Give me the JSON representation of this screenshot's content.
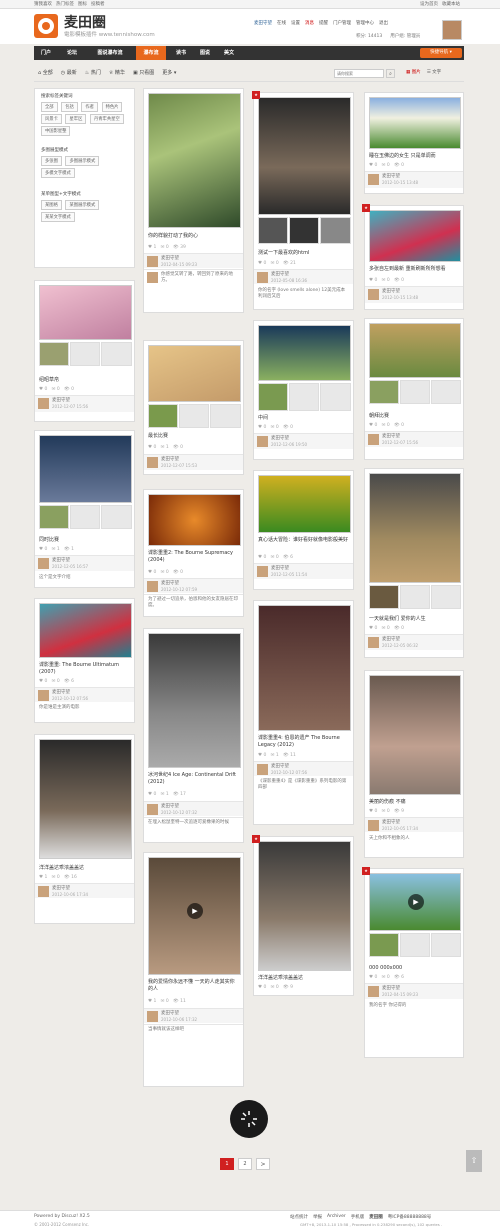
{
  "topbar": {
    "links": [
      "猜我喜欢",
      "热门标签",
      "图标",
      "投稿者"
    ],
    "right": [
      "设为首页",
      "收藏本站"
    ]
  },
  "header": {
    "logo_text": "麦田圈",
    "subtitle": "電影模板插件 www.tennishow.com",
    "user": "麦田守望",
    "status": "在线",
    "links": [
      "设置",
      "消息",
      "提醒",
      "门户管理",
      "管理中心",
      "退出"
    ],
    "score": "积分: 14413",
    "group": "用户组: 管理员"
  },
  "nav": {
    "items": [
      "门户",
      "论坛",
      "图说瀑布流",
      "瀑布流",
      "读书",
      "图说",
      "美文"
    ],
    "quick": "快捷导航"
  },
  "filter": {
    "items": [
      "全部",
      "最新",
      "热门",
      "精华",
      "只看图",
      "更多"
    ],
    "search_placeholder": "请你搜索",
    "view_a": "图片",
    "view_b": "文字"
  },
  "panel": {
    "sec1": "搜索标签关键词",
    "sec1_tags": [
      "全部",
      "包括",
      "作者",
      "特色片",
      "风景卡",
      "星牢区",
      "丹青牢共星空",
      "中国影星整"
    ],
    "sec2": "多图展型模式",
    "sec2_tags": [
      "多张图",
      "多图展示模式",
      "多模文字模式"
    ],
    "sec3": "某单图型+文字模式",
    "sec3_tags": [
      "某图格",
      "某图展示模式",
      "某某文字模式"
    ]
  },
  "cards": [
    {
      "title": "你的样貌打动了我的心",
      "user": "麦田守望",
      "action": "分享于",
      "date": "2012-04-15 09:23",
      "comment_user": "麦田守望",
      "comment": "你感觉又转了路，转回到了原来的地方。"
    },
    {
      "title": "测试一下最喜欢的html",
      "user": "麦田守望",
      "date": "2012-05-08 16:36",
      "comment": "你的名字 (love smells alone) 12美元成本利润后又后"
    },
    {
      "title": "睡在玉佛边的女生 只是单调而",
      "user": "麦田守望",
      "date": "2012-10-15 13:48"
    },
    {
      "title": "多张自左到最新 重新刷新所所想看",
      "user": "麦田守望",
      "date": "2012-10-15 13:48"
    },
    {
      "title": "绍昭草帛",
      "user": "麦田守望",
      "date": "2012-12-07 15:56"
    },
    {
      "title": "最长比赛",
      "user": "麦田守望",
      "date": "2012-12-07 15:53"
    },
    {
      "title": "中间",
      "user": "麦田守望",
      "date": "2012-12-06 19:50"
    },
    {
      "title": "朝拜比赛",
      "user": "麦田守望",
      "date": "2012-12-07 15:56"
    },
    {
      "title": "同时比赛",
      "user": "麦田守望",
      "date": "2012-12-05 16:57",
      "comment": "这个是文字介绍"
    },
    {
      "title": "谍影重重2: The Bourne Supremacy (2004)",
      "user": "麦田守望",
      "date": "2012-10-12 07:59",
      "comment": "为了避过一切追杀，伯恩和他的女友隐居在印度。"
    },
    {
      "title": "真心话大冒险：谁好看好就像电影般美好",
      "user": "麦田守望",
      "date": "2012-12-05 11:54"
    },
    {
      "title": "一天就是我们 爱你的人生",
      "user": "麦田守望",
      "date": "2012-12-05 06:32"
    },
    {
      "title": "谍影重重: The Bourne Ultimatum (2007)",
      "user": "麦田守望",
      "date": "2012-10-12 07:56",
      "comment": "你是谁是主演的电影"
    },
    {
      "title": "冰河世纪4 Ice Age: Continental Drift (2012)",
      "user": "麦田守望",
      "date": "2012-10-12 07:32",
      "comment": "在埋入松鼠奎特一次追逐可爱橡果的时候"
    },
    {
      "title": "谍影重重4: 伯恩的遗产 The Bourne Legacy (2012)",
      "user": "麦田守望",
      "date": "2012-10-12 07:56",
      "comment": "《谍影重重4》是《谍影重重》系列电影的第四部"
    },
    {
      "title": "美丽的伤痕 不痛",
      "user": "麦田守望",
      "date": "2012-10-05 17:34",
      "comment": "天上你和不相象的人"
    },
    {
      "title": "洋洋盖达乖浓盖盖达",
      "user": "麦田守望",
      "date": "2012-10-06 17:34"
    },
    {
      "title": "我的爱情你永远不懂 一天的人走其实你的人",
      "user": "麦田守望",
      "date": "2012-10-06 17:32",
      "comment": "当事情就该这样吧"
    },
    {
      "title": "洋洋盖达乖浓盖盖达",
      "user": "麦田守望",
      "date": "2012-10-06 17:34"
    },
    {
      "title": "000 000x000",
      "user": "麦田守望",
      "date": "2012-04-15 09:23",
      "comment": "我的名字 你记得的"
    }
  ],
  "pager": {
    "pages": [
      "1",
      "2"
    ],
    "next": ">"
  },
  "footer": {
    "powered": "Powered by Discuz! X2.5",
    "copyright": "© 2001-2012 Comsenz Inc.",
    "links": [
      "站点统计",
      "举报",
      "Archiver",
      "手机版",
      "麦田圈"
    ],
    "icp": "粤ICP备88888888号",
    "stats": "GMT+8, 2013-1-10 15:58 , Processed in 0.238290 second(s), 102 queries ."
  }
}
